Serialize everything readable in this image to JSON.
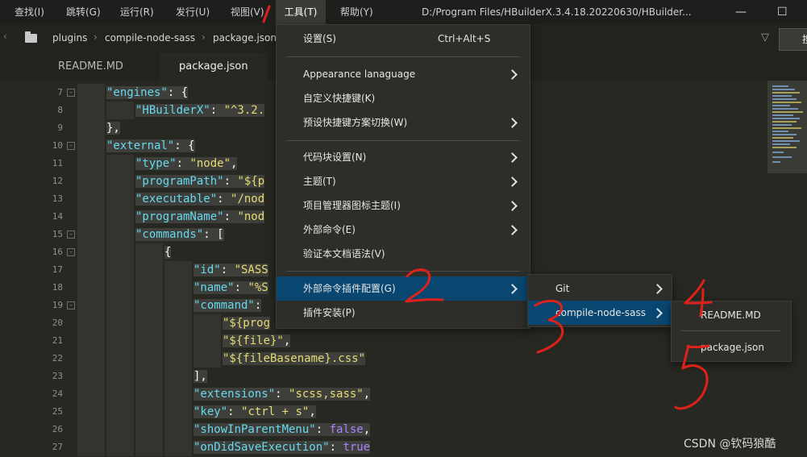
{
  "menubar": {
    "items": [
      "查找(I)",
      "跳转(G)",
      "运行(R)",
      "发行(U)",
      "视图(V)",
      "工具(T)",
      "帮助(Y)"
    ],
    "active_index": 5,
    "window_title": "D:/Program Files/HBuilderX.3.4.18.20220630/HBuilder...",
    "minimize": "—",
    "maximize": "☐"
  },
  "breadcrumb": {
    "segments": [
      "plugins",
      "compile-node-sass",
      "package.json"
    ],
    "search_button": "搜"
  },
  "tabs": [
    {
      "label": "README.MD",
      "active": false
    },
    {
      "label": "package.json",
      "active": true
    }
  ],
  "editor": {
    "line_numbers": [
      "7",
      "8",
      "9",
      "10",
      "11",
      "12",
      "13",
      "14",
      "15",
      "16",
      "17",
      "18",
      "19",
      "20",
      "21",
      "22",
      "23",
      "24",
      "25",
      "26",
      "27"
    ],
    "lines": [
      {
        "indent": 1,
        "parts": [
          [
            "k",
            "\"engines\""
          ],
          [
            "p",
            ": {"
          ]
        ]
      },
      {
        "indent": 2,
        "parts": [
          [
            "k",
            "\"HBuilderX\""
          ],
          [
            "p",
            ": "
          ],
          [
            "s",
            "\"^3.2."
          ]
        ]
      },
      {
        "indent": 1,
        "parts": [
          [
            "p",
            "},"
          ]
        ]
      },
      {
        "indent": 1,
        "parts": [
          [
            "k",
            "\"external\""
          ],
          [
            "p",
            ": {"
          ]
        ]
      },
      {
        "indent": 2,
        "parts": [
          [
            "k",
            "\"type\""
          ],
          [
            "p",
            ": "
          ],
          [
            "s",
            "\"node\""
          ],
          [
            "p",
            ","
          ]
        ]
      },
      {
        "indent": 2,
        "parts": [
          [
            "k",
            "\"programPath\""
          ],
          [
            "p",
            ": "
          ],
          [
            "s",
            "\"${p"
          ]
        ]
      },
      {
        "indent": 2,
        "parts": [
          [
            "k",
            "\"executable\""
          ],
          [
            "p",
            ": "
          ],
          [
            "s",
            "\"/nod"
          ]
        ]
      },
      {
        "indent": 2,
        "parts": [
          [
            "k",
            "\"programName\""
          ],
          [
            "p",
            ": "
          ],
          [
            "s",
            "\"nod"
          ]
        ]
      },
      {
        "indent": 2,
        "parts": [
          [
            "k",
            "\"commands\""
          ],
          [
            "p",
            ": ["
          ]
        ]
      },
      {
        "indent": 3,
        "parts": [
          [
            "p",
            "{"
          ]
        ]
      },
      {
        "indent": 4,
        "parts": [
          [
            "k",
            "\"id\""
          ],
          [
            "p",
            ": "
          ],
          [
            "s",
            "\"SASS"
          ]
        ]
      },
      {
        "indent": 4,
        "parts": [
          [
            "k",
            "\"name\""
          ],
          [
            "p",
            ": "
          ],
          [
            "s",
            "\"%S"
          ]
        ]
      },
      {
        "indent": 4,
        "parts": [
          [
            "k",
            "\"command\""
          ],
          [
            "p",
            ":"
          ]
        ]
      },
      {
        "indent": 5,
        "parts": [
          [
            "s",
            "\"${prog"
          ]
        ]
      },
      {
        "indent": 5,
        "parts": [
          [
            "s",
            "\"${file}\""
          ],
          [
            "p",
            ","
          ]
        ]
      },
      {
        "indent": 5,
        "parts": [
          [
            "s",
            "\"${fileBasename}.css\""
          ]
        ]
      },
      {
        "indent": 4,
        "parts": [
          [
            "p",
            "],"
          ]
        ]
      },
      {
        "indent": 4,
        "parts": [
          [
            "k",
            "\"extensions\""
          ],
          [
            "p",
            ": "
          ],
          [
            "s",
            "\"scss,sass\""
          ],
          [
            "p",
            ","
          ]
        ]
      },
      {
        "indent": 4,
        "parts": [
          [
            "k",
            "\"key\""
          ],
          [
            "p",
            ": "
          ],
          [
            "s",
            "\"ctrl + s\""
          ],
          [
            "p",
            ","
          ]
        ]
      },
      {
        "indent": 4,
        "parts": [
          [
            "k",
            "\"showInParentMenu\""
          ],
          [
            "p",
            ": "
          ],
          [
            "b",
            "false"
          ],
          [
            "p",
            ","
          ]
        ]
      },
      {
        "indent": 4,
        "parts": [
          [
            "k",
            "\"onDidSaveExecution\""
          ],
          [
            "p",
            ": "
          ],
          [
            "b",
            "true"
          ]
        ]
      }
    ],
    "fold_lines": [
      "7",
      "10",
      "15",
      "16",
      "19"
    ]
  },
  "tools_menu": {
    "items": [
      {
        "label": "设置(S)",
        "shortcut": "Ctrl+Alt+S",
        "submenu": false
      },
      {
        "divider": true
      },
      {
        "label": "Appearance lanaguage",
        "submenu": true
      },
      {
        "label": "自定义快捷键(K)",
        "submenu": false
      },
      {
        "label": "预设快捷键方案切换(W)",
        "submenu": true
      },
      {
        "divider": true
      },
      {
        "label": "代码块设置(N)",
        "submenu": true
      },
      {
        "label": "主题(T)",
        "submenu": true
      },
      {
        "label": "项目管理器图标主题(I)",
        "submenu": true
      },
      {
        "label": "外部命令(E)",
        "submenu": true
      },
      {
        "label": "验证本文档语法(V)",
        "submenu": false
      },
      {
        "divider": true
      },
      {
        "label": "外部命令插件配置(G)",
        "submenu": true,
        "selected": true
      },
      {
        "label": "插件安装(P)",
        "submenu": false
      }
    ]
  },
  "plugin_submenu": {
    "items": [
      {
        "label": "Git",
        "selected": false
      },
      {
        "label": "compile-node-sass",
        "selected": true
      }
    ]
  },
  "sass_submenu": {
    "items": [
      "README.MD",
      "package.json"
    ]
  },
  "annotations": [
    "1",
    "2",
    "3",
    "4",
    "5"
  ],
  "watermark": "CSDN @钦码狼酷",
  "colors": {
    "selection": "#094771",
    "annotation": "#e0201b",
    "background": "#272822"
  }
}
